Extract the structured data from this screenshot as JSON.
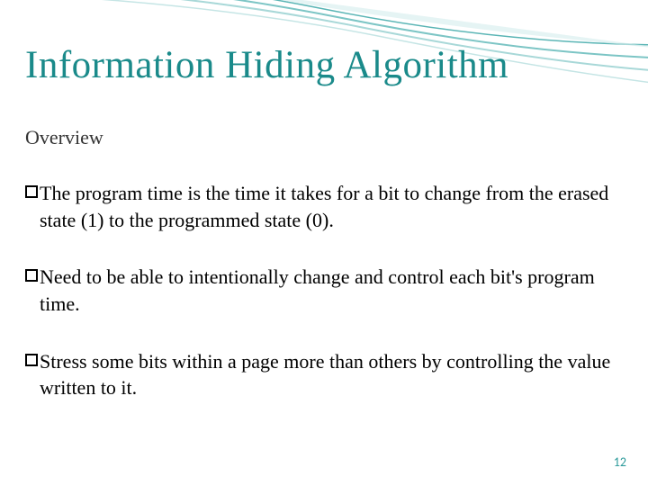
{
  "slide": {
    "title": "Information Hiding Algorithm",
    "subtitle": "Overview",
    "bullets": [
      "The program time is the time it takes for a bit to change from the erased state (1) to the programmed state (0).",
      "Need to be able to intentionally change and control each bit's program time.",
      "Stress some bits within a page more than others by controlling the value written to it."
    ],
    "pageNumber": "12"
  }
}
